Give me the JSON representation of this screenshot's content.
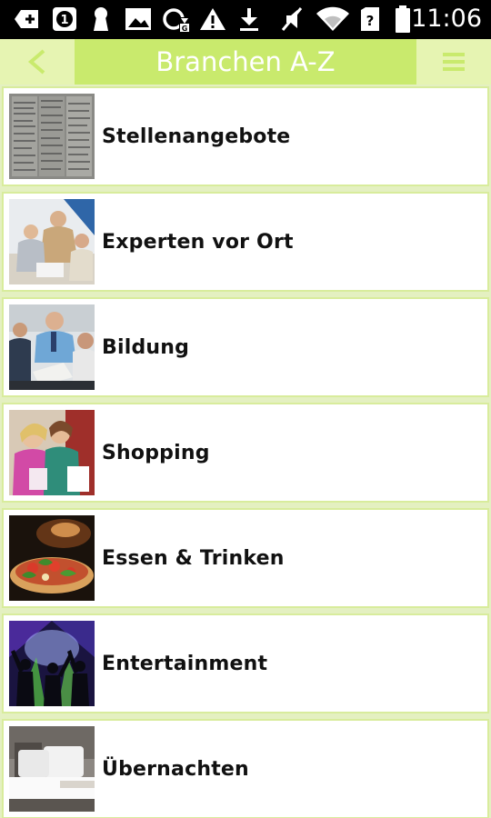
{
  "status_bar": {
    "time": "11:06",
    "icons": [
      "add-notification-icon",
      "one-badge-icon",
      "keyhole-icon",
      "image-icon",
      "sync-icon",
      "warning-icon",
      "download-icon",
      "mute-icon",
      "wifi-icon",
      "no-sim-icon",
      "battery-icon"
    ]
  },
  "toolbar": {
    "back_glyph": "<",
    "title": "Branchen A-Z",
    "menu_glyph": "≡"
  },
  "colors": {
    "accent": "#c9ea6d",
    "accent_light": "#e6f4b2",
    "list_border": "#d8ec9c"
  },
  "list": {
    "items": [
      {
        "label": "Stellenangebote",
        "thumbnail": "newspaper-classifieds-image"
      },
      {
        "label": "Experten vor Ort",
        "thumbnail": "office-meeting-image"
      },
      {
        "label": "Bildung",
        "thumbnail": "teacher-students-image"
      },
      {
        "label": "Shopping",
        "thumbnail": "shopping-women-image"
      },
      {
        "label": "Essen & Trinken",
        "thumbnail": "pizza-image"
      },
      {
        "label": "Entertainment",
        "thumbnail": "concert-crowd-image"
      },
      {
        "label": "Übernachten",
        "thumbnail": "hotel-bed-image"
      }
    ]
  }
}
